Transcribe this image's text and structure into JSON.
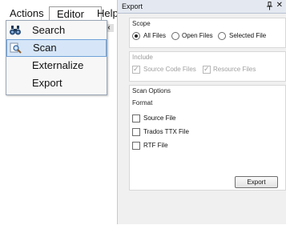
{
  "menubar": {
    "actions_label": "Actions",
    "editor_label": "Editor",
    "help_label": "Help"
  },
  "actions_menu": {
    "items": [
      {
        "label": "Search",
        "icon": "binoculars-icon"
      },
      {
        "label": "Scan",
        "icon": "scan-magnifier-icon",
        "highlighted": true
      },
      {
        "label": "Externalize"
      },
      {
        "label": "Export"
      }
    ]
  },
  "export_panel": {
    "title": "Export",
    "scope": {
      "title": "Scope",
      "options": [
        "All Files",
        "Open Files",
        "Selected File"
      ],
      "selected": "All Files"
    },
    "include": {
      "title": "Include",
      "options": [
        "Source Code Files",
        "Resource Files"
      ],
      "checked": [
        true,
        true
      ],
      "disabled": true
    },
    "scan_options": {
      "title": "Scan Options",
      "format_label": "Format",
      "formats": [
        "Source File",
        "Trados TTX File",
        "RTF File"
      ],
      "checked": [
        false,
        false,
        false
      ]
    },
    "export_button_label": "Export"
  },
  "colors": {
    "menu_highlight": "#d6e6f8",
    "menu_highlight_border": "#6fa1d8",
    "panel_background": "#f0f0f0",
    "titlebar_background": "#e4e9f1"
  }
}
